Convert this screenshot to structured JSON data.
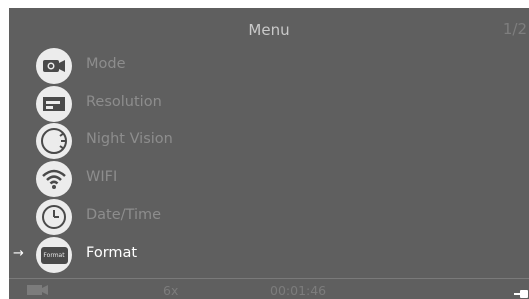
{
  "header": {
    "title": "Menu",
    "page_indicator": "1/2"
  },
  "menu": {
    "items": [
      {
        "label": "Mode",
        "icon": "camera-icon",
        "selected": false
      },
      {
        "label": "Resolution",
        "icon": "resolution-icon",
        "selected": false
      },
      {
        "label": "Night Vision",
        "icon": "night-vision-icon",
        "selected": false
      },
      {
        "label": "WIFI",
        "icon": "wifi-icon",
        "selected": false
      },
      {
        "label": "Date/Time",
        "icon": "clock-icon",
        "selected": false
      },
      {
        "label": "Format",
        "icon": "format-icon",
        "icon_text": "Format",
        "selected": true
      }
    ],
    "selected_arrow": "→"
  },
  "status_bar": {
    "zoom": "6x",
    "time": "00:01:46",
    "left_icon": "video-camera-icon",
    "right_icon": "battery-icon"
  }
}
